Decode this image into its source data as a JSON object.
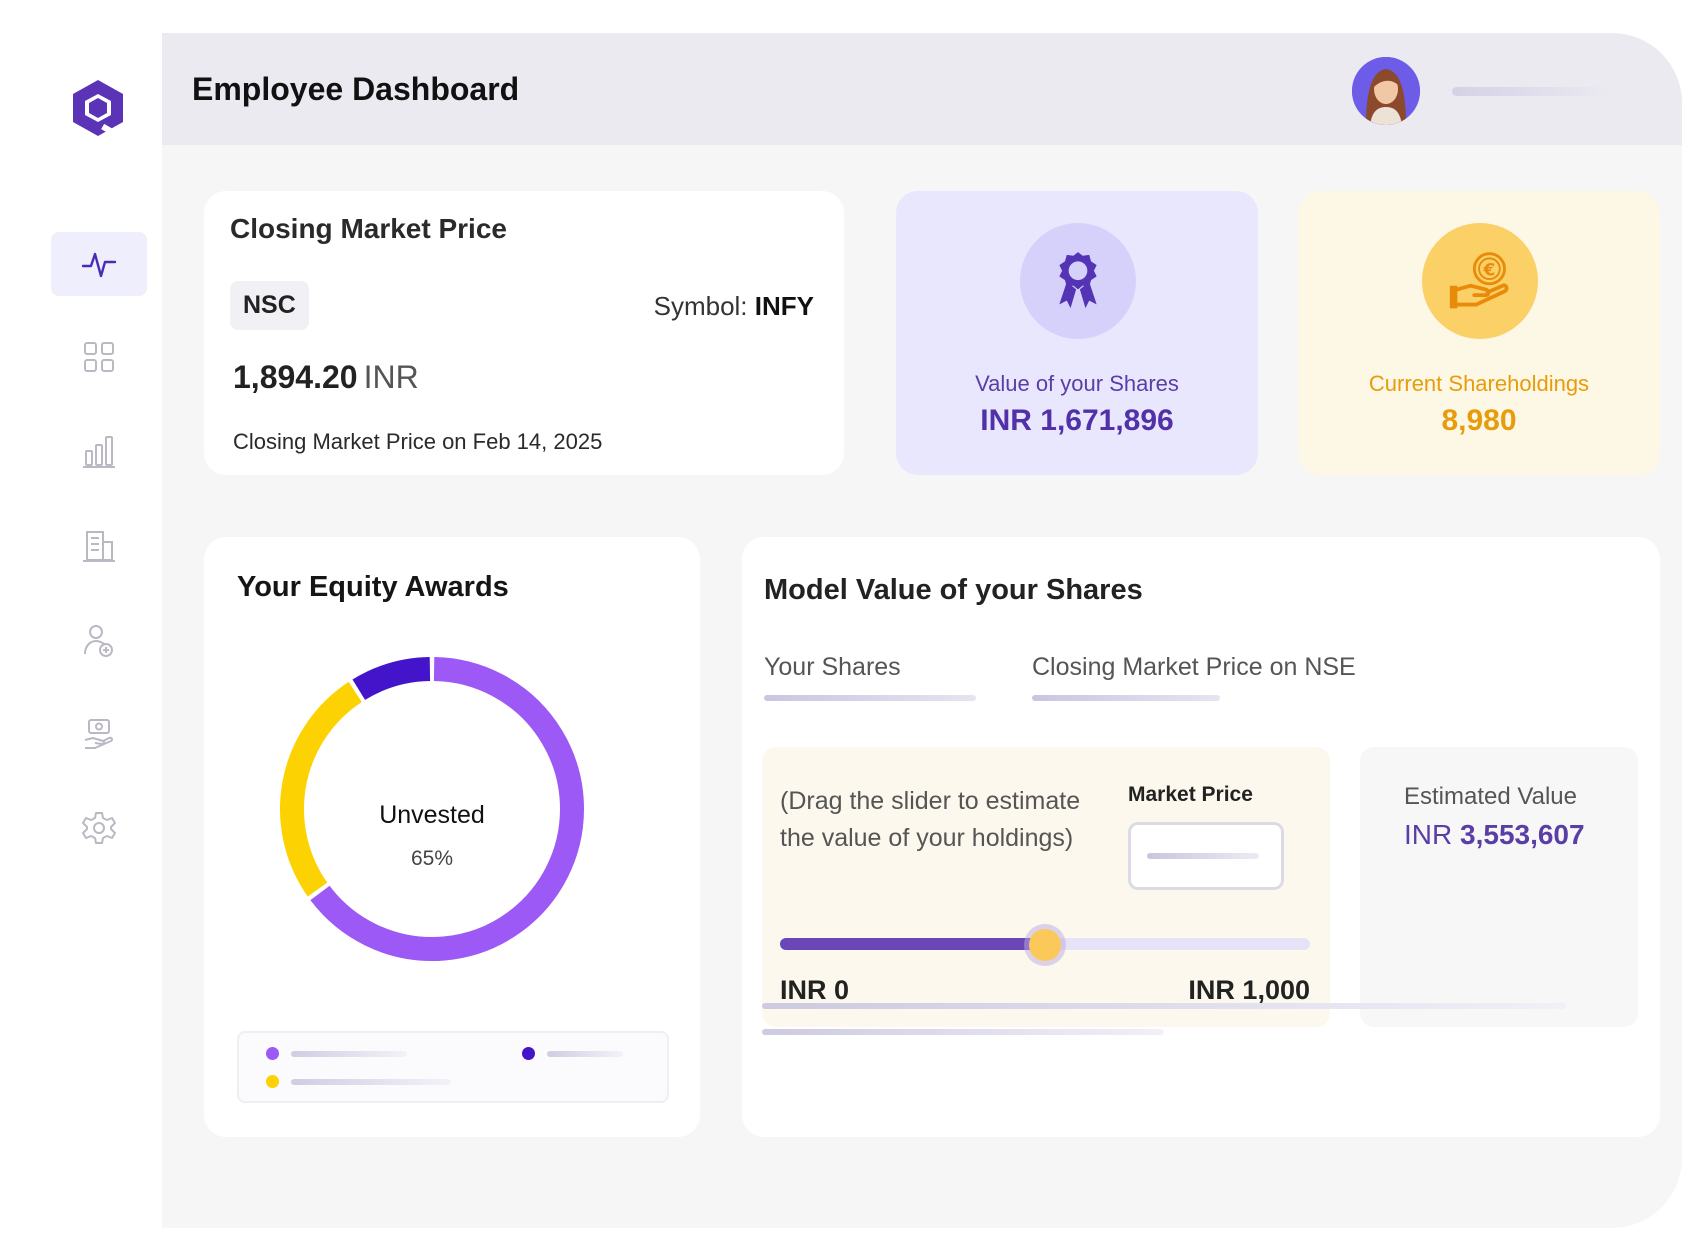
{
  "app": {
    "title": "Employee Dashboard"
  },
  "sidebar": {
    "items": [
      {
        "icon": "activity-icon",
        "active": true
      },
      {
        "icon": "grid-icon",
        "active": false
      },
      {
        "icon": "bar-chart-icon",
        "active": false
      },
      {
        "icon": "building-icon",
        "active": false
      },
      {
        "icon": "user-add-icon",
        "active": false
      },
      {
        "icon": "hand-money-icon",
        "active": false
      },
      {
        "icon": "settings-icon",
        "active": false
      }
    ]
  },
  "closing_price": {
    "title": "Closing Market Price",
    "exchange": "NSC",
    "symbol_label": "Symbol:",
    "symbol": "INFY",
    "price": "1,894.20",
    "unit": "INR",
    "subtitle": "Closing Market Price on Feb 14, 2025"
  },
  "stats": {
    "shares_value": {
      "label": "Value of your Shares",
      "value": "INR 1,671,896"
    },
    "shareholdings": {
      "label": "Current Shareholdings",
      "value": "8,980"
    }
  },
  "equity": {
    "title": "Your Equity Awards",
    "center_label": "Unvested",
    "center_value": "65%"
  },
  "chart_data": {
    "type": "pie",
    "donut": true,
    "title": "",
    "segments": [
      {
        "value": 65,
        "color": "#9c59f6"
      },
      {
        "value": 26,
        "color": "#fdd203"
      },
      {
        "value": 9,
        "color": "#4314c9"
      }
    ]
  },
  "model": {
    "title": "Model Value of your Shares",
    "tabs": [
      "Your Shares",
      "Closing Market Price on NSE"
    ],
    "hint": "(Drag the slider to estimate the value of your holdings)",
    "market_price_label": "Market Price",
    "slider": {
      "min_label": "INR 0",
      "max_label": "INR 1,000",
      "fraction": 0.5
    },
    "estimated": {
      "label": "Estimated Value",
      "prefix": "INR",
      "value": "3,553,607"
    }
  },
  "colors": {
    "accent": "#5a3ea6",
    "active_nav": "#efeefc",
    "yellow": "#e89c0c"
  }
}
